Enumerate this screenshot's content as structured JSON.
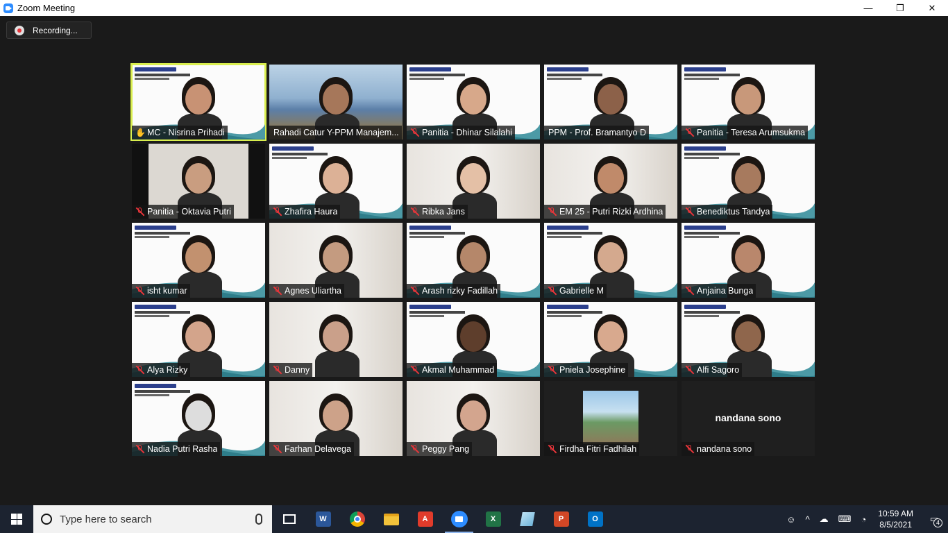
{
  "window": {
    "title": "Zoom Meeting",
    "minimize": "—",
    "maximize": "❐",
    "close": "✕"
  },
  "recording": {
    "label": "Recording..."
  },
  "participants": [
    {
      "name": "MC - Nisrina Prihadi",
      "status": "hand"
    },
    {
      "name": "Rahadi Catur Y-PPM Manajem...",
      "status": "none"
    },
    {
      "name": "Panitia - Dhinar Silalahi",
      "status": "muted"
    },
    {
      "name": "PPM - Prof. Bramantyo D",
      "status": "none"
    },
    {
      "name": "Panitia - Teresa Arumsukma",
      "status": "muted"
    },
    {
      "name": "Panitia - Oktavia Putri",
      "status": "muted"
    },
    {
      "name": "Zhafira Haura",
      "status": "muted"
    },
    {
      "name": "Ribka Jans",
      "status": "muted"
    },
    {
      "name": "EM 25 - Putri Rizki Ardhina",
      "status": "muted"
    },
    {
      "name": "Benediktus Tandya",
      "status": "muted"
    },
    {
      "name": "isht kumar",
      "status": "muted"
    },
    {
      "name": "Agnes Uliartha",
      "status": "muted"
    },
    {
      "name": "Arash rizky Fadillah",
      "status": "muted"
    },
    {
      "name": "Gabrielle M",
      "status": "muted"
    },
    {
      "name": "Anjaina Bunga",
      "status": "muted"
    },
    {
      "name": "Alya Rizky",
      "status": "muted"
    },
    {
      "name": "Danny",
      "status": "muted"
    },
    {
      "name": "Akmal Muhammad",
      "status": "muted"
    },
    {
      "name": "Pniela Josephine",
      "status": "muted"
    },
    {
      "name": "Alfi Sagoro",
      "status": "muted"
    },
    {
      "name": "Nadia Putri Rasha",
      "status": "muted"
    },
    {
      "name": "Farhan Delavega",
      "status": "muted"
    },
    {
      "name": "Peggy Pang",
      "status": "muted"
    },
    {
      "name": "Firdha Fitri Fadhilah",
      "status": "muted"
    },
    {
      "name": "nandana sono",
      "status": "muted"
    }
  ],
  "no_video_label": "nandana sono",
  "taskbar": {
    "search_placeholder": "Type here to search",
    "apps": [
      "task-view",
      "word",
      "chrome",
      "file-explorer",
      "acrobat",
      "zoom",
      "excel",
      "notepad",
      "powerpoint",
      "outlook"
    ],
    "time": "10:59 AM",
    "date": "8/5/2021",
    "notifications": "4"
  },
  "colors": {
    "active_speaker": "#d9ee4e",
    "muted": "#e8353a",
    "zoom_blue": "#2d8cff",
    "taskbar": "#1c2330"
  }
}
